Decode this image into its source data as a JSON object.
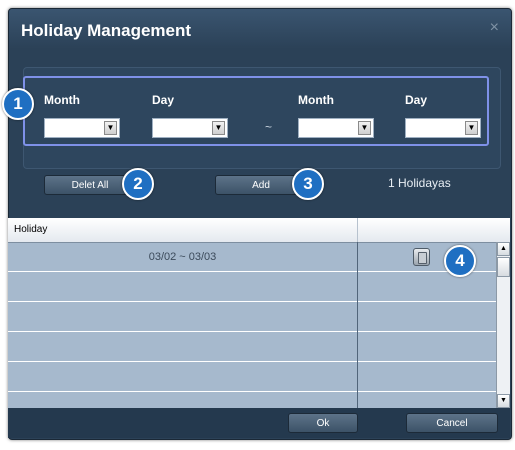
{
  "dialog": {
    "title": "Holiday Management",
    "close_icon": "×"
  },
  "date_range": {
    "start_month_label": "Month",
    "start_day_label": "Day",
    "separator": "~",
    "end_month_label": "Month",
    "end_day_label": "Day",
    "start_month_value": "",
    "start_day_value": "",
    "end_month_value": "",
    "end_day_value": ""
  },
  "actions": {
    "delete_all_label": "Delet All",
    "add_label": "Add",
    "holiday_count": "1  Holidayas"
  },
  "table": {
    "header_holiday": "Holiday",
    "header_action": "",
    "rows": [
      {
        "holiday": "03/02 ~ 03/03",
        "has_delete": true
      },
      {
        "holiday": "",
        "has_delete": false
      },
      {
        "holiday": "",
        "has_delete": false
      },
      {
        "holiday": "",
        "has_delete": false
      },
      {
        "holiday": "",
        "has_delete": false
      }
    ]
  },
  "footer": {
    "ok_label": "Ok",
    "cancel_label": "Cancel"
  },
  "callouts": [
    "1",
    "2",
    "3",
    "4"
  ],
  "icons": {
    "dropdown": "chevron-down-icon",
    "delete": "trash-icon",
    "scroll_up": "arrow-up-icon",
    "scroll_down": "arrow-down-icon"
  }
}
